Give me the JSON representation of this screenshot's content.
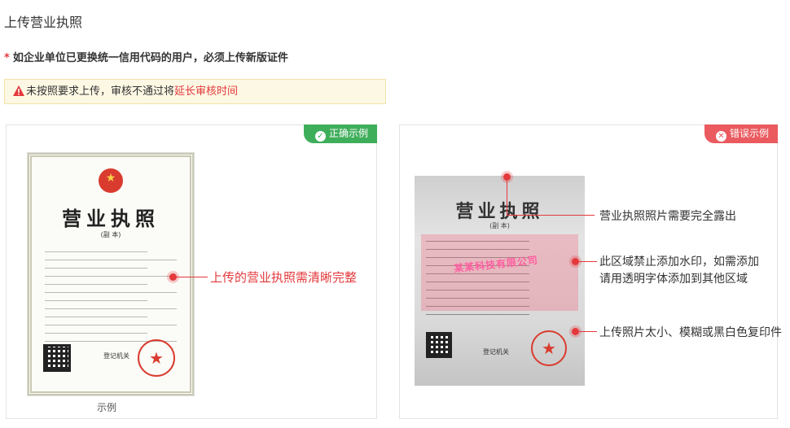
{
  "page_title": "上传营业执照",
  "requirement": {
    "star": "*",
    "text": "如企业单位已更换统一信用代码的用户，必须上传新版证件"
  },
  "warning": {
    "prefix": "未按照要求上传，审核不通过将",
    "highlight": "延长审核时间"
  },
  "correct_card": {
    "ribbon": "正确示例",
    "license_title": "营业执照",
    "license_sub": "(副 本)",
    "registration_office": "登记机关",
    "annotation": "上传的营业执照需清晰完整",
    "caption": "示例"
  },
  "wrong_card": {
    "ribbon": "错误示例",
    "license_title": "营业执照",
    "license_sub": "(副 本)",
    "watermark": "某某科技有限公司",
    "registration_office": "登记机关",
    "annotations": [
      "营业执照照片需要完全露出",
      "此区域禁止添加水印，如需添加\n请用透明字体添加到其他区域",
      "上传照片太小、模糊或黑白色复印件"
    ]
  },
  "colors": {
    "accent_red": "#e4393c",
    "ok_green": "#3fae5b",
    "err_red": "#ea5a5f",
    "warning_bg": "#fdf8e4"
  }
}
